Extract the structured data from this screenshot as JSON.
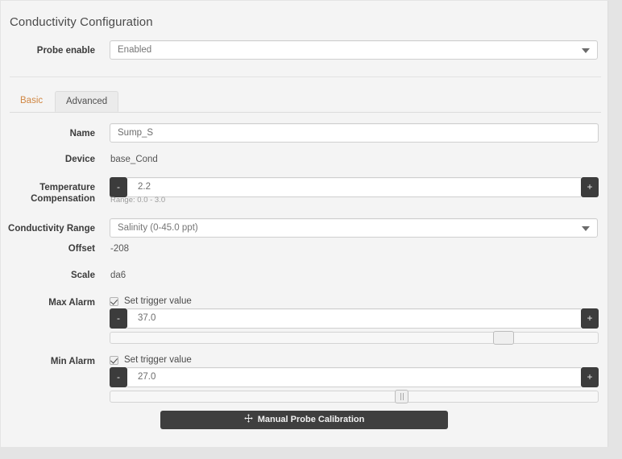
{
  "page": {
    "title": "Conductivity Configuration",
    "background_color": "#e4e4e4",
    "panel_color": "#f4f4f4",
    "accent_color": "#d08743"
  },
  "probe_enable": {
    "label": "Probe enable",
    "value": "Enabled",
    "caret_icon": "chevron-down-icon"
  },
  "tabs": [
    {
      "label": "Basic",
      "active": false
    },
    {
      "label": "Advanced",
      "active": true
    }
  ],
  "fields": {
    "name": {
      "label": "Name",
      "value": "Sump_S"
    },
    "device": {
      "label": "Device",
      "value": "base_Cond"
    },
    "temperature_compensation": {
      "label_line1": "Temperature",
      "label_line2": "Compensation",
      "value": "2.2",
      "hint": "Range: 0.0 - 3.0",
      "minus": "-",
      "plus": "+"
    },
    "conductivity_range": {
      "label": "Conductivity Range",
      "value": "Salinity (0-45.0 ppt)",
      "caret_icon": "chevron-down-icon"
    },
    "offset": {
      "label": "Offset",
      "value": "-208"
    },
    "scale": {
      "label": "Scale",
      "value": "da6"
    },
    "max_alarm": {
      "label": "Max Alarm",
      "checkbox_label": "Set trigger value",
      "checked": true,
      "value": "37.0",
      "minus": "-",
      "plus": "+",
      "slider_percent": 82
    },
    "min_alarm": {
      "label": "Min Alarm",
      "checkbox_label": "Set trigger value",
      "checked": true,
      "value": "27.0",
      "minus": "-",
      "plus": "+",
      "slider_percent": 60
    }
  },
  "calibration_button": {
    "label": "Manual Probe Calibration",
    "icon": "move-crosshair-icon"
  }
}
